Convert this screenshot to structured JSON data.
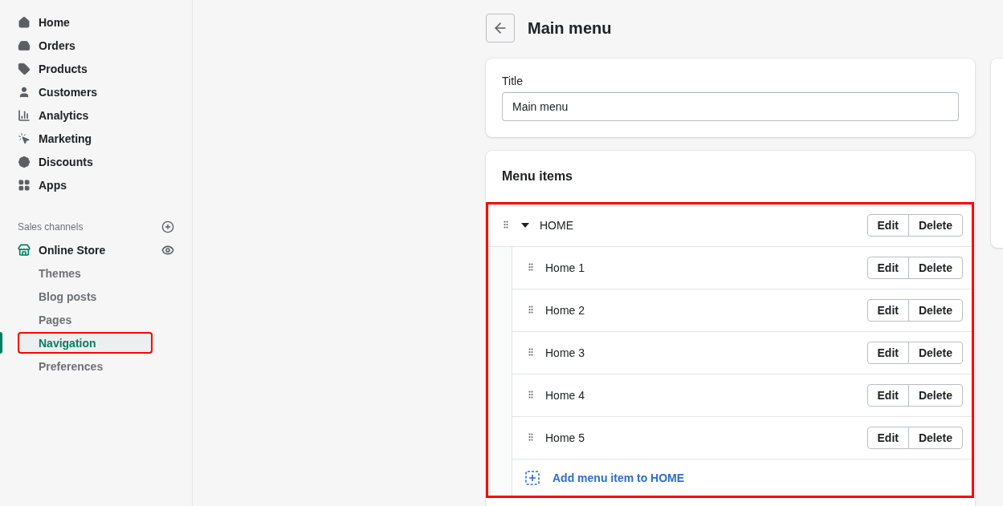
{
  "sidebar": {
    "items": [
      {
        "label": "Home"
      },
      {
        "label": "Orders"
      },
      {
        "label": "Products"
      },
      {
        "label": "Customers"
      },
      {
        "label": "Analytics"
      },
      {
        "label": "Marketing"
      },
      {
        "label": "Discounts"
      },
      {
        "label": "Apps"
      }
    ],
    "sales_channels": {
      "heading": "Sales channels",
      "channel": {
        "label": "Online Store"
      },
      "subitems": [
        {
          "label": "Themes",
          "selected": false,
          "highlighted": false
        },
        {
          "label": "Blog posts",
          "selected": false,
          "highlighted": false
        },
        {
          "label": "Pages",
          "selected": false,
          "highlighted": false
        },
        {
          "label": "Navigation",
          "selected": true,
          "highlighted": true
        },
        {
          "label": "Preferences",
          "selected": false,
          "highlighted": false
        }
      ]
    }
  },
  "page": {
    "title": "Main menu"
  },
  "title_card": {
    "label": "Title",
    "value": "Main menu"
  },
  "menu_card": {
    "heading": "Menu items",
    "highlighted": true,
    "items": [
      {
        "label": "HOME",
        "expanded": true,
        "actions": [
          "Edit",
          "Delete"
        ],
        "children": [
          {
            "label": "Home 1",
            "actions": [
              "Edit",
              "Delete"
            ]
          },
          {
            "label": "Home 2",
            "actions": [
              "Edit",
              "Delete"
            ]
          },
          {
            "label": "Home 3",
            "actions": [
              "Edit",
              "Delete"
            ]
          },
          {
            "label": "Home 4",
            "actions": [
              "Edit",
              "Delete"
            ]
          },
          {
            "label": "Home 5",
            "actions": [
              "Edit",
              "Delete"
            ]
          }
        ],
        "add_link": "Add menu item to HOME"
      }
    ]
  }
}
